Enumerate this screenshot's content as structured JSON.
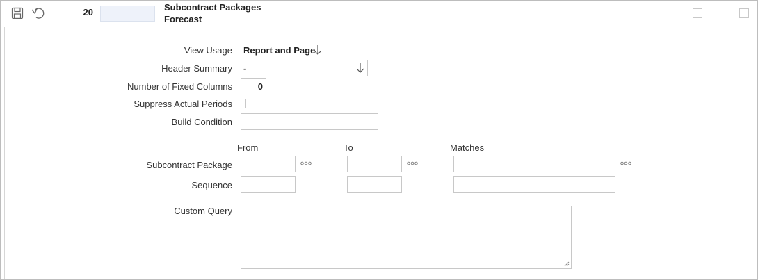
{
  "header": {
    "sequence": "20",
    "title_line1": "Subcontract Packages",
    "title_line2": "Forecast",
    "icons": [
      "save-icon",
      "undo-icon"
    ]
  },
  "form": {
    "view_usage": {
      "label": "View Usage",
      "value": "Report and Page"
    },
    "header_summary": {
      "label": "Header Summary",
      "value": "-"
    },
    "fixed_columns": {
      "label": "Number of Fixed Columns",
      "value": "0"
    },
    "suppress_actual": {
      "label": "Suppress Actual Periods",
      "checked": false
    },
    "build_condition": {
      "label": "Build Condition",
      "value": ""
    }
  },
  "ranges": {
    "col_from": "From",
    "col_to": "To",
    "col_matches": "Matches",
    "subcontract_package": {
      "label": "Subcontract Package",
      "from": "",
      "to": "",
      "matches": ""
    },
    "sequence": {
      "label": "Sequence",
      "from": "",
      "to": "",
      "matches": ""
    }
  },
  "custom_query": {
    "label": "Custom Query",
    "value": ""
  }
}
